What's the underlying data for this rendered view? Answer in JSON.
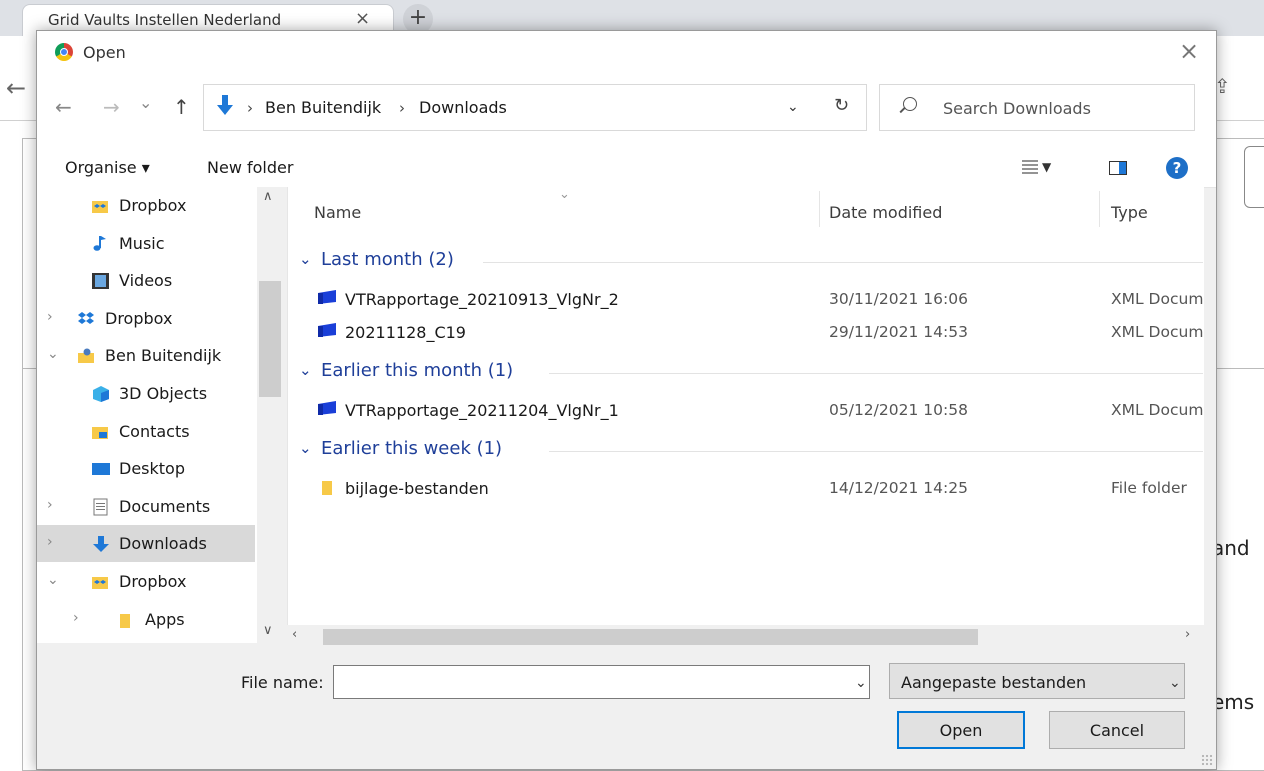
{
  "browser": {
    "tab_title": "Grid Vaults Instellen Nederland",
    "tab_close": "×",
    "new_tab": "+",
    "page_fragments": [
      "and",
      "ems"
    ]
  },
  "dialog": {
    "title": "Open",
    "close": "×",
    "nav": {
      "back": "←",
      "forward": "→",
      "recent": "⌄",
      "up": "↑"
    },
    "breadcrumb": [
      "Ben Buitendijk",
      "Downloads"
    ],
    "breadcrumb_sep": "›",
    "search_placeholder": "Search Downloads",
    "toolbar": {
      "organise": "Organise ▾",
      "new_folder": "New folder"
    },
    "nav_pane": [
      {
        "label": "Dropbox",
        "expander": "",
        "icon": "dropbox-folder-icon",
        "indent": 2
      },
      {
        "label": "Music",
        "expander": "",
        "icon": "music-icon",
        "indent": 2
      },
      {
        "label": "Videos",
        "expander": "",
        "icon": "videos-icon",
        "indent": 2
      },
      {
        "label": "Dropbox",
        "expander": "›",
        "icon": "dropbox-icon",
        "indent": 1
      },
      {
        "label": "Ben Buitendijk",
        "expander": "⌄",
        "icon": "user-folder-icon",
        "indent": 1
      },
      {
        "label": "3D Objects",
        "expander": "",
        "icon": "3d-objects-icon",
        "indent": 2
      },
      {
        "label": "Contacts",
        "expander": "",
        "icon": "contacts-icon",
        "indent": 2
      },
      {
        "label": "Desktop",
        "expander": "",
        "icon": "desktop-icon",
        "indent": 2
      },
      {
        "label": "Documents",
        "expander": "›",
        "icon": "documents-icon",
        "indent": 2
      },
      {
        "label": "Downloads",
        "expander": "›",
        "icon": "downloads-icon",
        "indent": 2,
        "selected": true
      },
      {
        "label": "Dropbox",
        "expander": "⌄",
        "icon": "dropbox-folder-icon",
        "indent": 2
      },
      {
        "label": "Apps",
        "expander": "›",
        "icon": "folder-icon",
        "indent": 3
      }
    ],
    "columns": [
      "Name",
      "Date modified",
      "Type"
    ],
    "groups": [
      {
        "label": "Last month (2)",
        "files": [
          {
            "name": "VTRapportage_20210913_VlgNr_2",
            "date": "30/11/2021 16:06",
            "type": "XML Docum",
            "icon": "xml-file-icon"
          },
          {
            "name": "20211128_C19",
            "date": "29/11/2021 14:53",
            "type": "XML Docum",
            "icon": "xml-file-icon"
          }
        ]
      },
      {
        "label": "Earlier this month (1)",
        "files": [
          {
            "name": "VTRapportage_20211204_VlgNr_1",
            "date": "05/12/2021 10:58",
            "type": "XML Docum",
            "icon": "xml-file-icon"
          }
        ]
      },
      {
        "label": "Earlier this week (1)",
        "files": [
          {
            "name": "bijlage-bestanden",
            "date": "14/12/2021 14:25",
            "type": "File folder",
            "icon": "folder-icon"
          }
        ]
      }
    ],
    "file_name_label": "File name:",
    "file_name_value": "",
    "file_type": "Aangepaste bestanden",
    "open_button": "Open",
    "cancel_button": "Cancel"
  },
  "colors": {
    "accent": "#0078d7",
    "group_header": "#1f3f99",
    "selected": "#d9d9d9"
  }
}
